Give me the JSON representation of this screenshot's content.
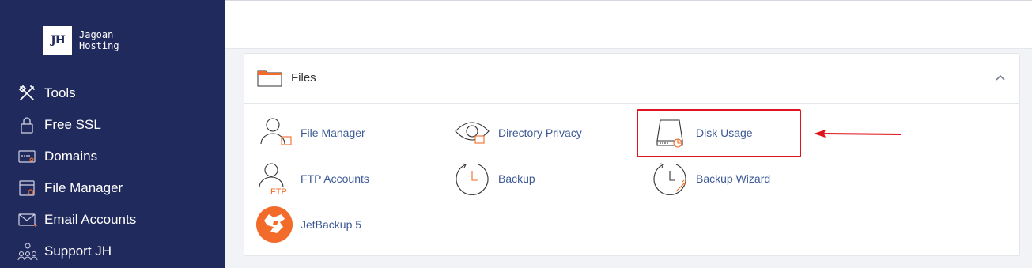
{
  "brand": {
    "mark": "JH",
    "line1": "Jagoan",
    "line2": "Hosting_"
  },
  "sidebar": {
    "items": [
      {
        "label": "Tools",
        "icon": "tools-icon"
      },
      {
        "label": "Free SSL",
        "icon": "lock-icon"
      },
      {
        "label": "Domains",
        "icon": "domain-icon"
      },
      {
        "label": "File Manager",
        "icon": "file-manager-icon"
      },
      {
        "label": "Email Accounts",
        "icon": "email-icon"
      },
      {
        "label": "Support JH",
        "icon": "support-icon"
      }
    ]
  },
  "files_panel": {
    "title": "Files",
    "items": [
      {
        "label": "File Manager",
        "icon": "file-manager-icon"
      },
      {
        "label": "Directory Privacy",
        "icon": "eye-folder-icon"
      },
      {
        "label": "Disk Usage",
        "icon": "disk-usage-icon"
      },
      {
        "label": "FTP Accounts",
        "icon": "ftp-accounts-icon",
        "icon_text": "FTP"
      },
      {
        "label": "Backup",
        "icon": "backup-icon"
      },
      {
        "label": "Backup Wizard",
        "icon": "backup-wizard-icon"
      },
      {
        "label": "JetBackup 5",
        "icon": "jetbackup-icon"
      }
    ]
  },
  "colors": {
    "sidebar_bg": "#212a5c",
    "link": "#3d5a96",
    "accent_orange": "#f26b2a",
    "highlight_red": "#e0141e"
  }
}
